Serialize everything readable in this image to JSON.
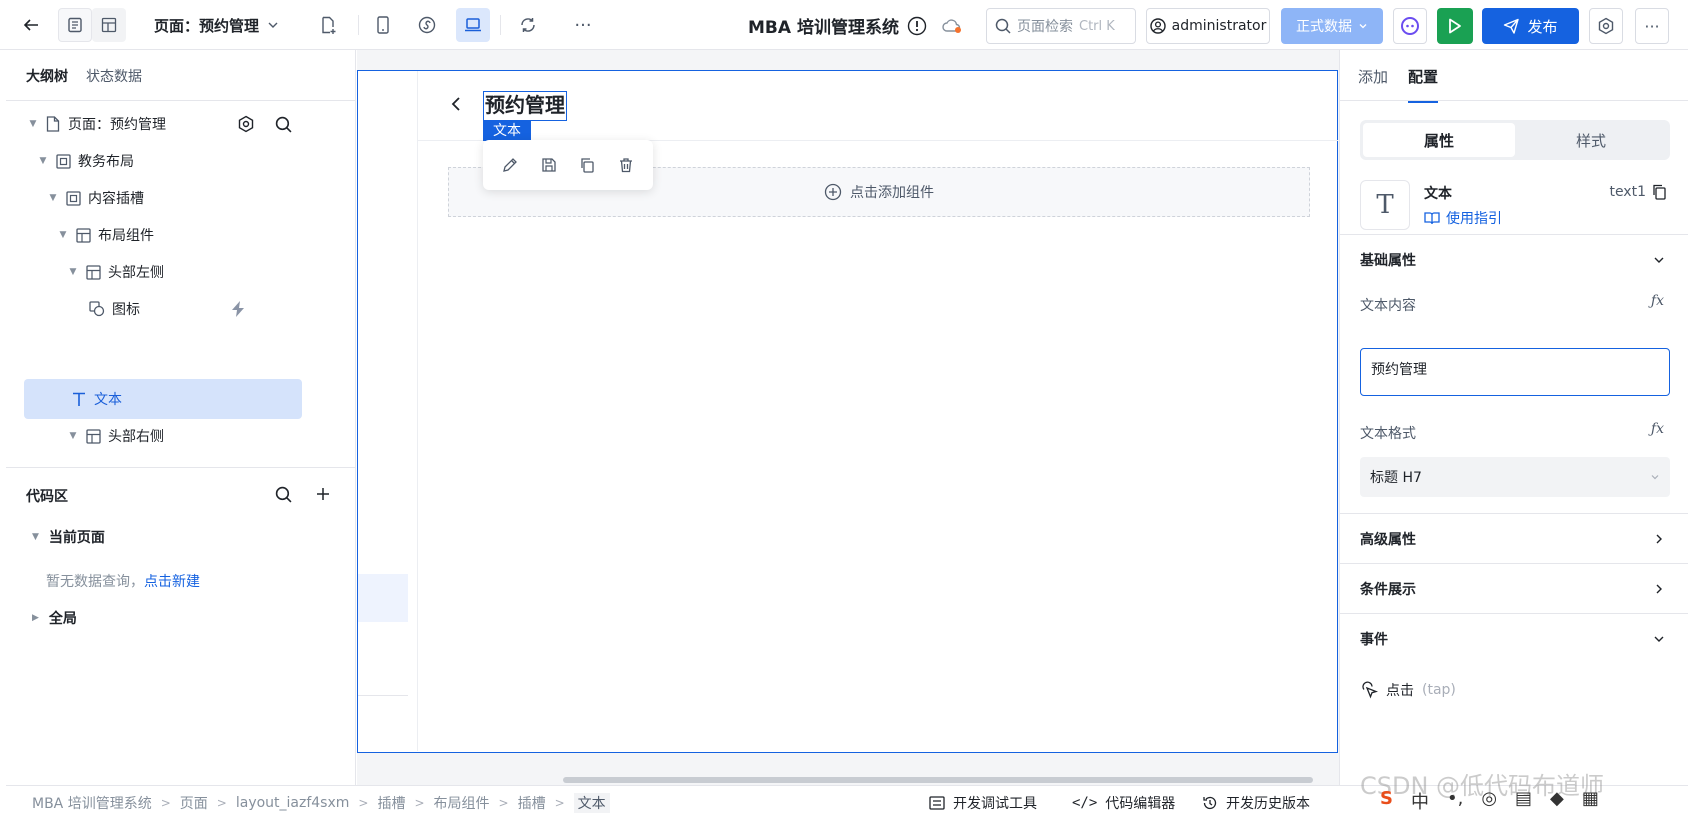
{
  "topbar": {
    "page_selector": "页面：预约管理",
    "app_title": "MBA 培训管理系统",
    "search_placeholder": "页面检索",
    "search_shortcut": "Ctrl K",
    "user": "administrator",
    "env": "正式数据",
    "publish": "发布"
  },
  "left": {
    "tabs": [
      "大纲树",
      "状态数据"
    ],
    "tree": [
      {
        "label": "页面：预约管理",
        "icon": "page-icon"
      },
      {
        "label": "教务布局",
        "icon": "block-icon"
      },
      {
        "label": "内容插槽",
        "icon": "block-icon"
      },
      {
        "label": "布局组件",
        "icon": "layout-icon"
      },
      {
        "label": "头部左侧",
        "icon": "layout-icon"
      },
      {
        "label": "图标",
        "icon": "shapes-icon"
      },
      {
        "label": "文本",
        "icon": "text-icon"
      },
      {
        "label": "头部右侧",
        "icon": "layout-icon"
      }
    ],
    "code_area": "代码区",
    "current_page": "当前页面",
    "no_data": "暂无数据查询，",
    "create_new": "点击新建",
    "global": "全局"
  },
  "canvas": {
    "selected_text": "预约管理",
    "selected_tag": "文本",
    "add_component": "点击添加组件"
  },
  "right": {
    "tabs": [
      "添加",
      "配置"
    ],
    "segments": [
      "属性",
      "样式"
    ],
    "component_name": "文本",
    "component_id": "text1",
    "usage_guide": "使用指引",
    "basic_props": "基础属性",
    "text_content_label": "文本内容",
    "text_content_value": "预约管理",
    "text_format_label": "文本格式",
    "text_format_value": "标题 H7",
    "advanced": "高级属性",
    "condition": "条件展示",
    "events": "事件",
    "event_name": "点击",
    "event_code": "(tap)"
  },
  "bottom": {
    "crumbs": [
      "MBA 培训管理系统",
      "页面",
      "layout_iazf4sxm",
      "插槽",
      "布局组件",
      "插槽",
      "文本"
    ],
    "dev_tools": "开发调试工具",
    "code_editor": "代码编辑器",
    "history": "开发历史版本",
    "watermark": "CSDN @低代码布道师"
  }
}
